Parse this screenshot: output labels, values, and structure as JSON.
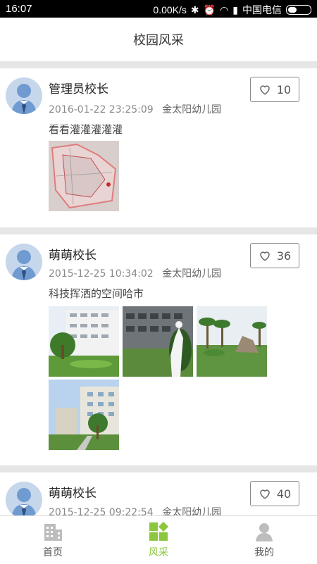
{
  "statusbar": {
    "time": "16:07",
    "speed": "0.00K/s",
    "carrier": "中国电信"
  },
  "header": {
    "title": "校园风采"
  },
  "posts": [
    {
      "author": "管理员校长",
      "datetime": "2016-01-22 23:25:09",
      "school": "金太阳幼儿园",
      "text": "看看灌灌灌灌灌",
      "likes": "10",
      "photos": [
        "floor-plan-photo"
      ]
    },
    {
      "author": "萌萌校长",
      "datetime": "2015-12-25 10:34:02",
      "school": "金太阳幼儿园",
      "text": "科技挥洒的空间哈市",
      "likes": "36",
      "photos": [
        "campus-courtyard-photo",
        "statue-building-photo",
        "palm-garden-photo",
        "tower-building-photo"
      ]
    },
    {
      "author": "萌萌校长",
      "datetime": "2015-12-25 09:22:54",
      "school": "金太阳幼儿园",
      "likes": "40"
    }
  ],
  "tabs": [
    {
      "label": "首页",
      "icon": "building-icon",
      "active": false
    },
    {
      "label": "风采",
      "icon": "blocks-icon",
      "active": true
    },
    {
      "label": "我的",
      "icon": "person-icon",
      "active": false
    }
  ],
  "colors": {
    "accent": "#8dc63f",
    "separator": "#e6e6e6"
  }
}
